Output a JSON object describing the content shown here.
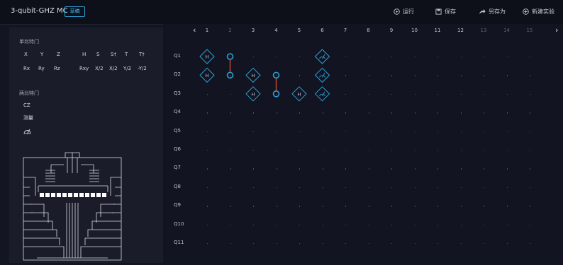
{
  "header": {
    "title": "3-qubit-GHZ MC",
    "badge": "草稿",
    "actions": [
      {
        "label": "运行",
        "icon": "play-icon"
      },
      {
        "label": "保存",
        "icon": "save-icon"
      },
      {
        "label": "另存为",
        "icon": "share-icon"
      },
      {
        "label": "新建实验",
        "icon": "add-icon"
      }
    ]
  },
  "sidebar": {
    "single_title": "单比特门",
    "single_row1": [
      "X",
      "Y",
      "Z",
      "H",
      "S",
      "S†",
      "T",
      "T†"
    ],
    "single_row2": [
      "Rx",
      "Ry",
      "Rz",
      "Rxy",
      "X/2",
      "X/2",
      "Y/2",
      "-Y/2"
    ],
    "multi_title": "两比特门",
    "multi_items": [
      "CZ",
      "测量"
    ],
    "measure_icon": "measure-icon",
    "chip_image": "chip-layout-image"
  },
  "grid": {
    "columns": [
      "1",
      "2",
      "3",
      "4",
      "5",
      "6",
      "7",
      "8",
      "9",
      "10",
      "11",
      "12",
      "13",
      "14",
      "15"
    ],
    "qubits": [
      "Q1",
      "Q2",
      "Q3",
      "Q4",
      "Q5",
      "Q6",
      "Q7",
      "Q8",
      "Q9",
      "Q10",
      "Q11"
    ],
    "gate_label": "H"
  },
  "colors": {
    "accent": "#2aa0d8",
    "cz_line": "#d6452d",
    "background": "#131622"
  }
}
